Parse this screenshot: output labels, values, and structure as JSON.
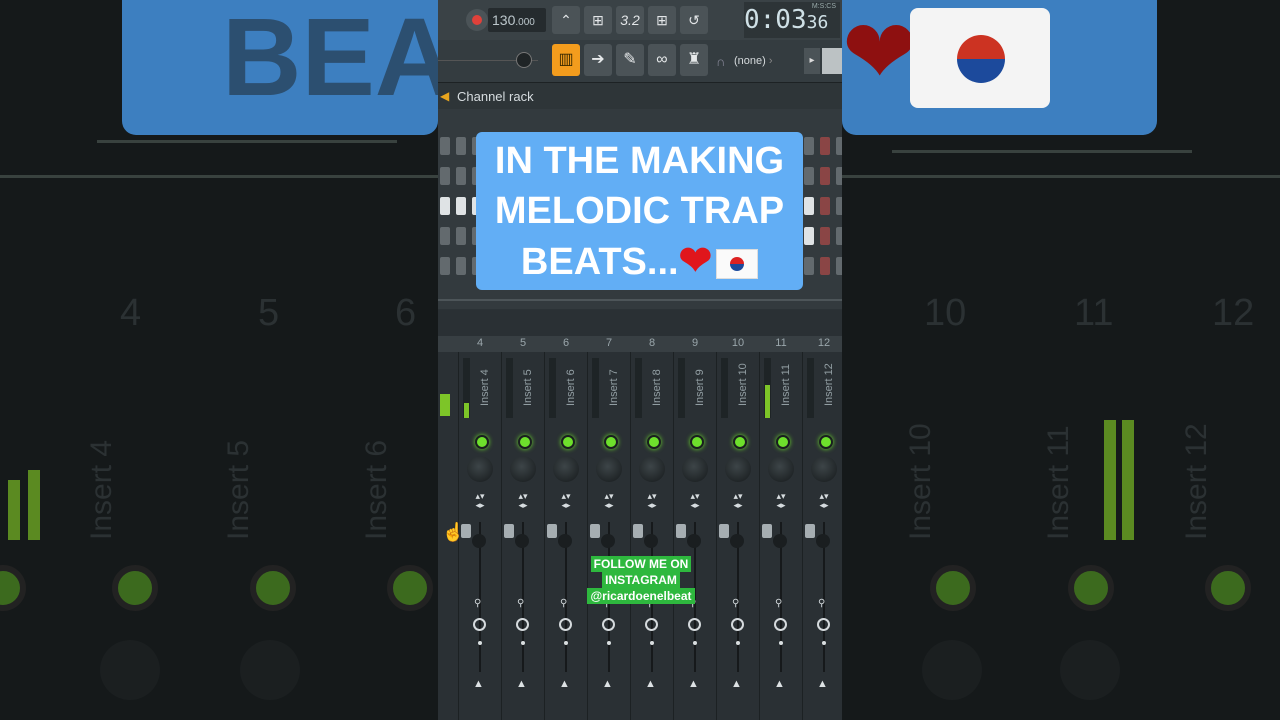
{
  "toolbar": {
    "tempo_main": "130",
    "tempo_frac": ".000",
    "time_main": "0:03",
    "time_sub": "36",
    "time_format_label": "M:S:CS",
    "pattern_select": "(none)"
  },
  "channel_rack": {
    "title": "Channel rack"
  },
  "mixer": {
    "strips": [
      {
        "num": "4",
        "name": "Insert 4"
      },
      {
        "num": "5",
        "name": "Insert 5"
      },
      {
        "num": "6",
        "name": "Insert 6"
      },
      {
        "num": "7",
        "name": "Insert 7"
      },
      {
        "num": "8",
        "name": "Insert 8"
      },
      {
        "num": "9",
        "name": "Insert 9"
      },
      {
        "num": "10",
        "name": "Insert 10"
      },
      {
        "num": "11",
        "name": "Insert 11"
      },
      {
        "num": "12",
        "name": "Insert 12"
      }
    ]
  },
  "overlay": {
    "title_line1": "IN THE MAKING",
    "title_line2": "MELODIC TRAP",
    "title_line3": "BEATS...",
    "follow_line1": "FOLLOW ME ON",
    "follow_line2": "INSTAGRAM",
    "follow_handle": "@ricardoenelbeat"
  },
  "background": {
    "left_banner_text": "BEA",
    "left_numbers": [
      "4",
      "5",
      "6"
    ],
    "left_inserts": [
      "Insert 4",
      "Insert 5",
      "Insert 6"
    ],
    "right_numbers": [
      "10",
      "11",
      "12"
    ],
    "right_inserts": [
      "Insert 10",
      "Insert 11",
      "Insert 12"
    ]
  },
  "colors": {
    "accent_orange": "#f39c1d",
    "led_green": "#6ee02c",
    "card_blue": "#62aef5",
    "insta_green": "#2eb83e"
  }
}
